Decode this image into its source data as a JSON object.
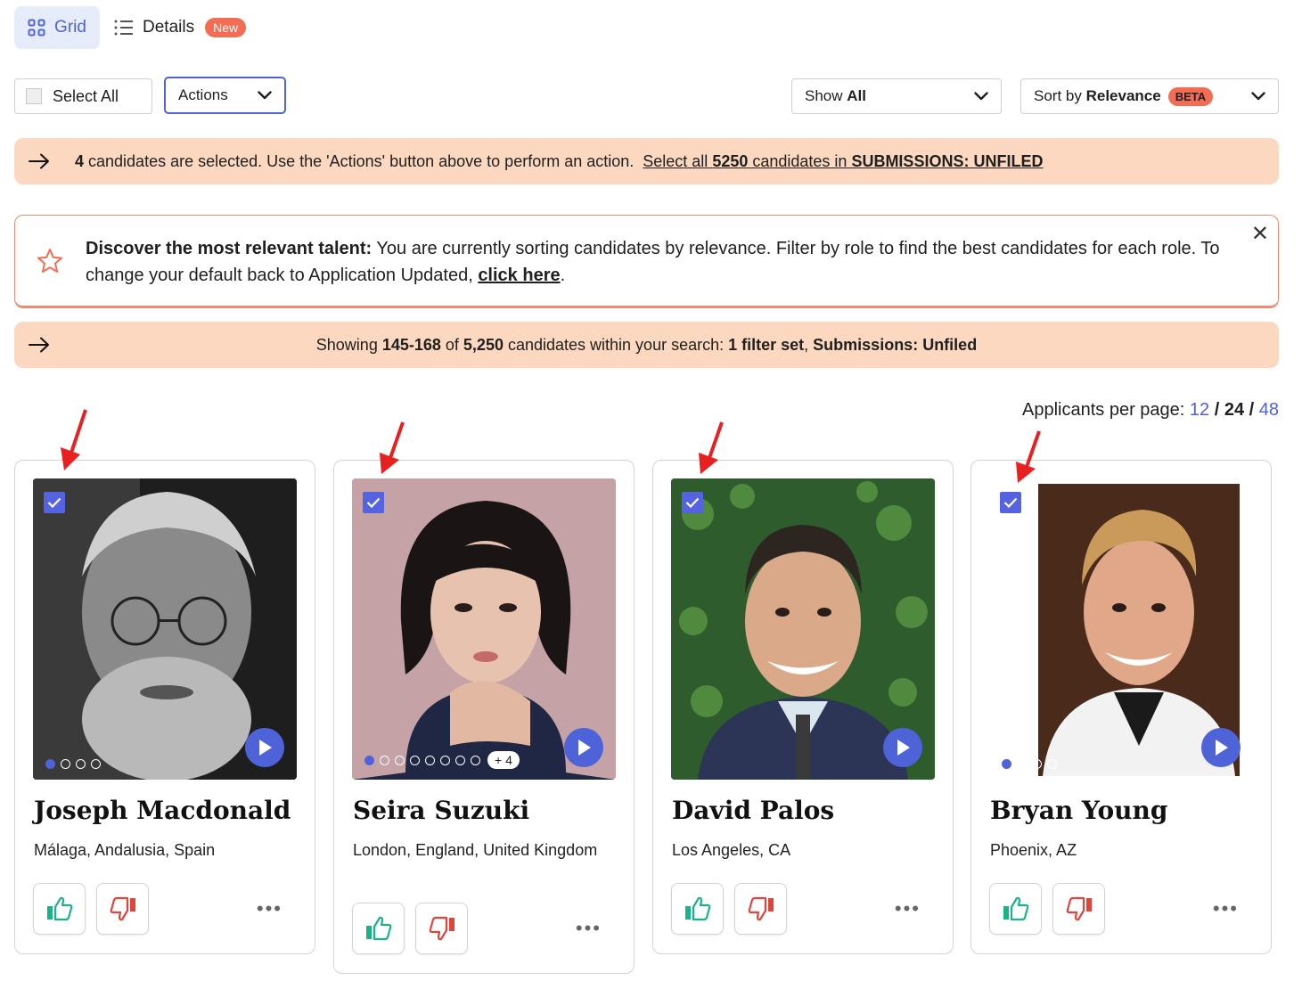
{
  "view_toggle": {
    "grid_label": "Grid",
    "details_label": "Details",
    "details_badge": "New"
  },
  "toolbar": {
    "select_all_label": "Select All",
    "actions_label": "Actions",
    "show_prefix": "Show ",
    "show_value": "All",
    "sort_prefix": "Sort by ",
    "sort_value": "Relevance",
    "sort_badge": "BETA"
  },
  "selected_banner": {
    "count": "4",
    "text": " candidates are selected. Use the 'Actions' button above to perform an action.",
    "link_prefix": "Select all ",
    "link_count": "5250",
    "link_middle": " candidates in ",
    "link_scope": "SUBMISSIONS: UNFILED"
  },
  "discover_banner": {
    "heading": "Discover the most relevant talent:",
    "text": " You are currently sorting candidates by relevance. Filter by role to find the best candidates for each role. To change your default back to Application Updated, ",
    "link": "click here",
    "suffix": "."
  },
  "showing_banner": {
    "prefix": "Showing ",
    "range": "145-168",
    "of": " of ",
    "total": "5,250",
    "middle": " candidates within your search:  ",
    "filters": "1 filter set",
    "sep": ",  ",
    "scope": "Submissions: Unfiled"
  },
  "per_page": {
    "label": "Applicants per page: ",
    "options": [
      "12",
      "24",
      "48"
    ],
    "active": "24",
    "sep": " / "
  },
  "candidates": [
    {
      "name": "Joseph Macdonald",
      "location": "Málaga, Andalusia, Spain",
      "dots": 4,
      "extra": ""
    },
    {
      "name": "Seira Suzuki",
      "location": "London, England, United Kingdom",
      "dots": 8,
      "extra": "+ 4"
    },
    {
      "name": "David Palos",
      "location": "Los Angeles, CA",
      "dots": 0,
      "extra": ""
    },
    {
      "name": "Bryan Young",
      "location": "Phoenix, AZ",
      "dots": 4,
      "extra": ""
    }
  ],
  "colors": {
    "accent": "#4f63d9",
    "banner": "#fbd8bf",
    "badge": "#f26d53",
    "annotation_arrow": "#e8201f"
  }
}
